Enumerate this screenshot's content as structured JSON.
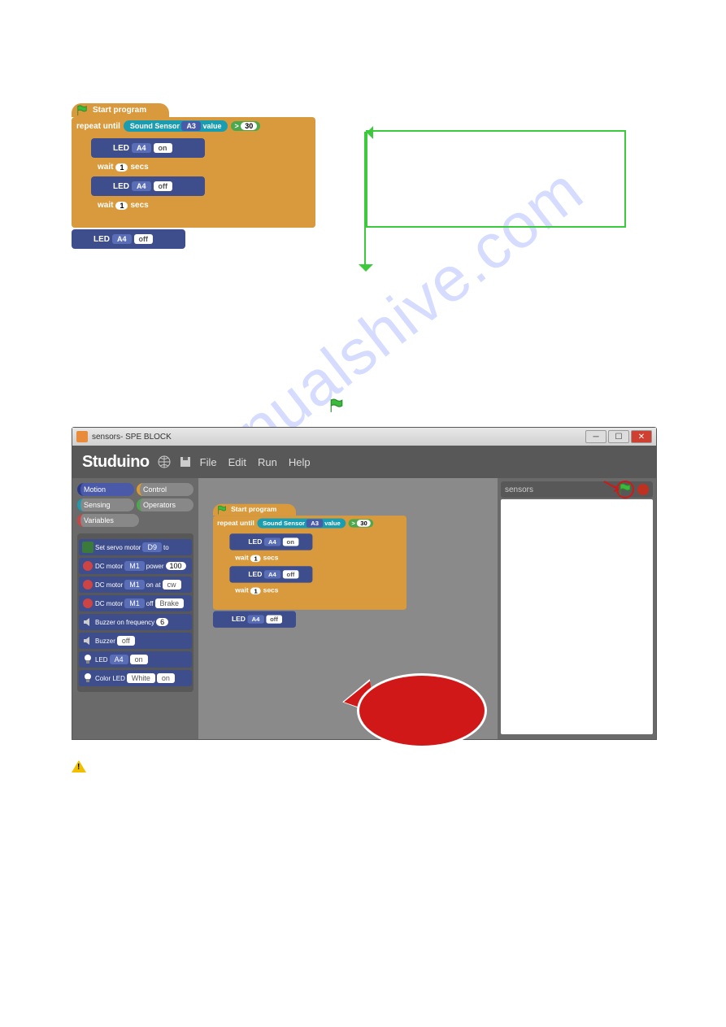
{
  "top_program": {
    "hat": "Start program",
    "repeat": {
      "label": "repeat until",
      "sensor": "Sound Sensor",
      "port": "A3",
      "word": "value",
      "op": ">",
      "thresh": "30"
    },
    "wait1": {
      "label": "wait",
      "n": "1",
      "unit": "secs"
    },
    "wait2": {
      "label": "wait",
      "n": "1",
      "unit": "secs"
    },
    "led_on": {
      "label": "LED",
      "port": "A4",
      "state": "on"
    },
    "led_off": {
      "label": "LED",
      "port": "A4",
      "state": "off"
    },
    "led_final": {
      "label": "LED",
      "port": "A4",
      "state": "off"
    }
  },
  "window": {
    "title": "sensors- SPE BLOCK",
    "logo": "Studuino",
    "menu": [
      "File",
      "Edit",
      "Run",
      "Help"
    ],
    "categories": {
      "motion": "Motion",
      "control": "Control",
      "sensing": "Sensing",
      "operators": "Operators",
      "variables": "Variables"
    },
    "palette": {
      "servo": {
        "label": "Set servo motor",
        "port": "D9",
        "word": "to"
      },
      "dcm_p": {
        "label": "DC motor",
        "port": "M1",
        "word": "power",
        "val": "100"
      },
      "dcm_on": {
        "label": "DC motor",
        "port": "M1",
        "word": "on at",
        "dir": "cw"
      },
      "dcm_off": {
        "label": "DC motor",
        "port": "M1",
        "word": "off",
        "mode": "Brake"
      },
      "buzf": {
        "label": "Buzzer",
        "word": "on frequency",
        "val": "6"
      },
      "buzoff": {
        "label": "Buzzer",
        "state": "off"
      },
      "led": {
        "label": "LED",
        "port": "A4",
        "state": "on"
      },
      "cled": {
        "label": "Color LED",
        "color": "White",
        "state": "on"
      }
    },
    "stage_title": "sensors"
  },
  "watermark": "manualshive.com"
}
